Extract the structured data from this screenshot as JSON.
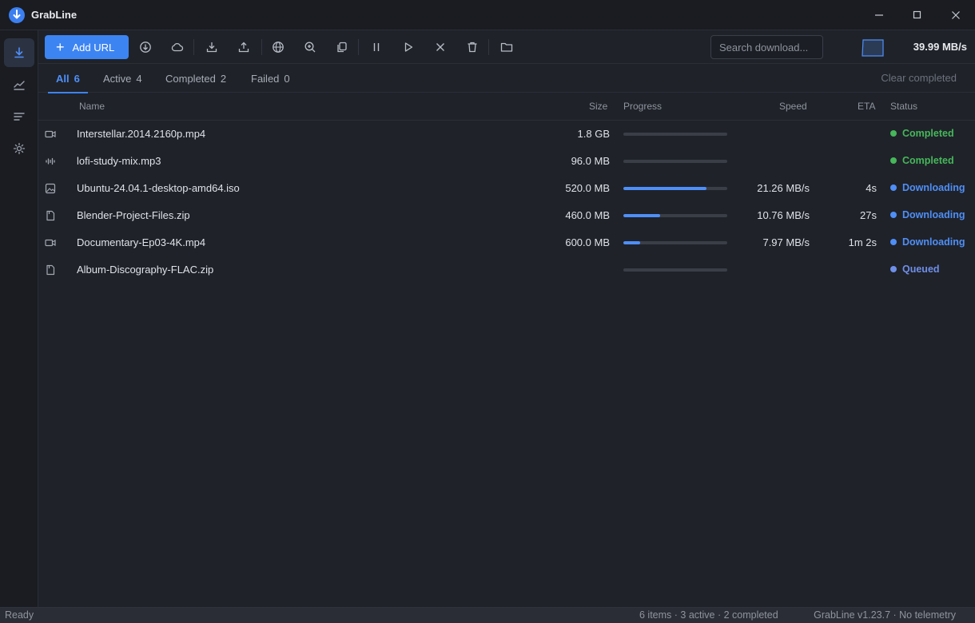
{
  "app": {
    "title": "GrabLine"
  },
  "toolbar": {
    "add_label": "Add URL",
    "search_placeholder": "Search download...",
    "rate": "39.99 MB/s"
  },
  "tabs": [
    {
      "label": "All",
      "count": "6"
    },
    {
      "label": "Active",
      "count": "4"
    },
    {
      "label": "Completed",
      "count": "2"
    },
    {
      "label": "Failed",
      "count": "0"
    }
  ],
  "clear_label": "Clear completed",
  "columns": {
    "name": "Name",
    "size": "Size",
    "progress": "Progress",
    "speed": "Speed",
    "eta": "ETA",
    "status": "Status"
  },
  "rows": [
    {
      "icon": "video-file-icon",
      "name": "Interstellar.2014.2160p.mp4",
      "size": "1.8 GB",
      "progress": 0,
      "speed": "",
      "eta": "",
      "status": "Completed"
    },
    {
      "icon": "audio-file-icon",
      "name": "lofi-study-mix.mp3",
      "size": "96.0 MB",
      "progress": 0,
      "speed": "",
      "eta": "",
      "status": "Completed"
    },
    {
      "icon": "image-file-icon",
      "name": "Ubuntu-24.04.1-desktop-amd64.iso",
      "size": "520.0 MB",
      "progress": 0.8,
      "speed": "21.26 MB/s",
      "eta": "4s",
      "status": "Downloading"
    },
    {
      "icon": "document-file-icon",
      "name": "Blender-Project-Files.zip",
      "size": "460.0 MB",
      "progress": 0.35,
      "speed": "10.76 MB/s",
      "eta": "27s",
      "status": "Downloading"
    },
    {
      "icon": "video-file-icon",
      "name": "Documentary-Ep03-4K.mp4",
      "size": "600.0 MB",
      "progress": 0.16,
      "speed": "7.97 MB/s",
      "eta": "1m 2s",
      "status": "Downloading"
    },
    {
      "icon": "document-file-icon",
      "name": "Album-Discography-FLAC.zip",
      "size": "",
      "progress": 0,
      "speed": "",
      "eta": "",
      "status": "Queued"
    }
  ],
  "status_colors": {
    "Completed": "#46b75a",
    "Downloading": "#4f8ff7",
    "Queued": "#6f8fe8"
  },
  "statusbar": {
    "left": "Ready",
    "summary": "6 items · 3 active · 2 completed",
    "version": "GrabLine v1.23.7 · No telemetry"
  }
}
